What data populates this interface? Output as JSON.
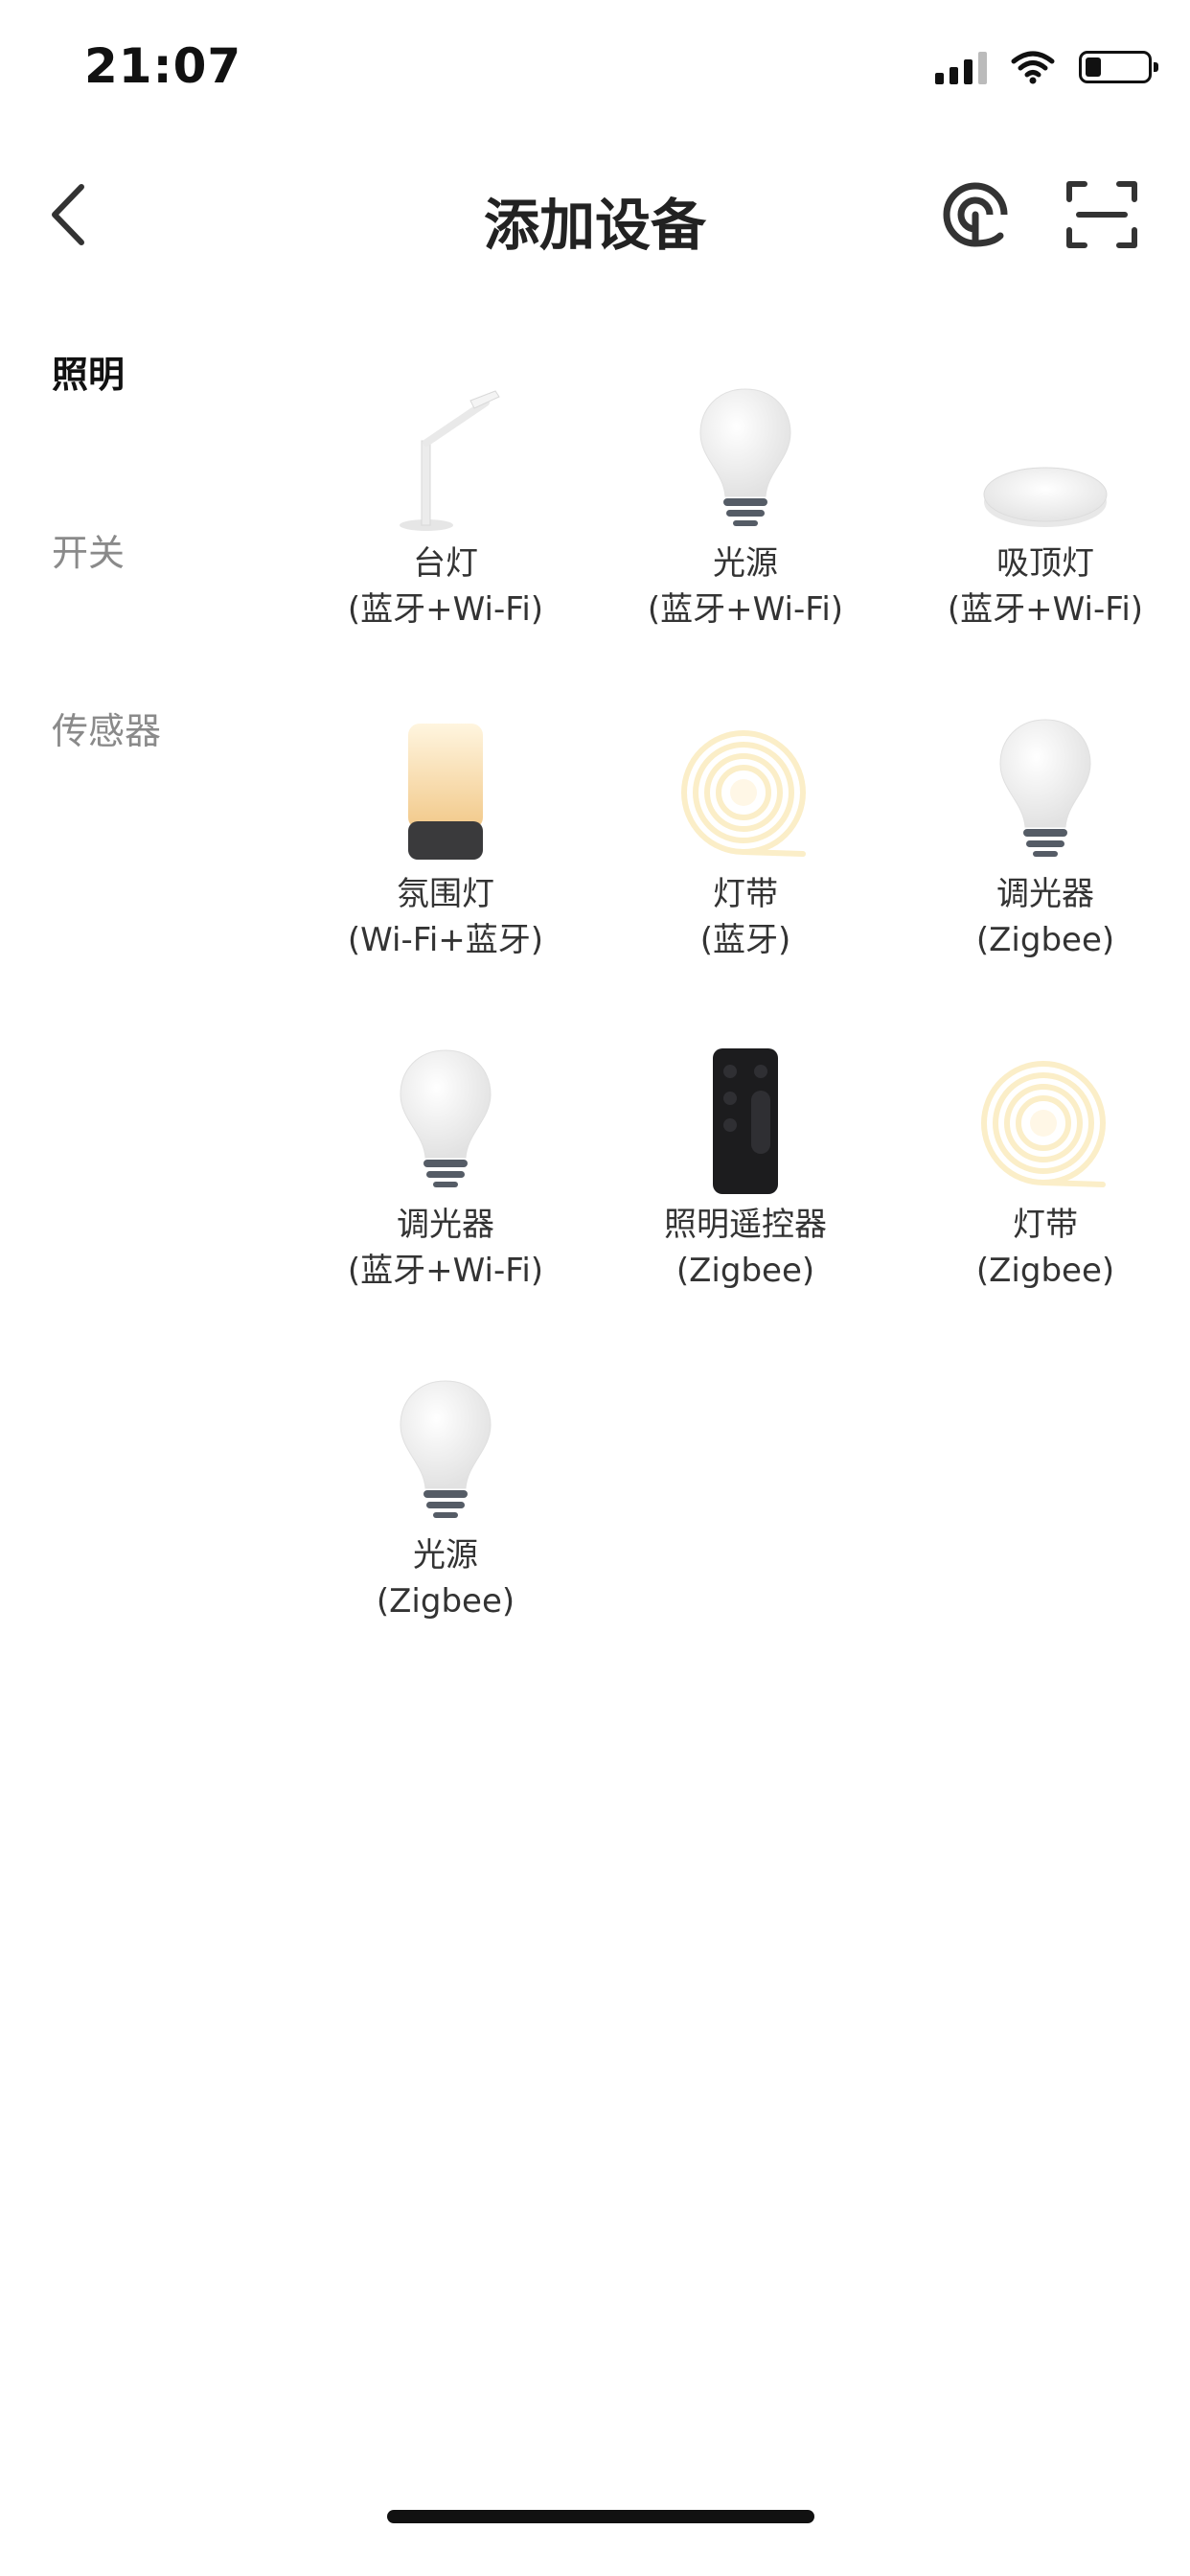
{
  "status": {
    "time": "21:07"
  },
  "nav": {
    "title": "添加设备"
  },
  "categories": [
    {
      "label": "照明",
      "active": true
    },
    {
      "label": "开关",
      "active": false
    },
    {
      "label": "传感器",
      "active": false
    }
  ],
  "devices": [
    {
      "name": "台灯",
      "protocol": "(蓝牙+Wi-Fi)",
      "icon": "desk-lamp-icon"
    },
    {
      "name": "光源",
      "protocol": "(蓝牙+Wi-Fi)",
      "icon": "bulb-icon"
    },
    {
      "name": "吸顶灯",
      "protocol": "(蓝牙+Wi-Fi)",
      "icon": "ceiling-light-icon"
    },
    {
      "name": "氛围灯",
      "protocol": "(Wi-Fi+蓝牙)",
      "icon": "ambient-light-icon"
    },
    {
      "name": "灯带",
      "protocol": "(蓝牙)",
      "icon": "light-strip-icon"
    },
    {
      "name": "调光器",
      "protocol": "(Zigbee)",
      "icon": "bulb-icon"
    },
    {
      "name": "调光器",
      "protocol": "(蓝牙+Wi-Fi)",
      "icon": "bulb-icon"
    },
    {
      "name": "照明遥控器",
      "protocol": "(Zigbee)",
      "icon": "remote-control-icon"
    },
    {
      "name": "灯带",
      "protocol": "(Zigbee)",
      "icon": "light-strip-icon"
    },
    {
      "name": "光源",
      "protocol": "(Zigbee)",
      "icon": "bulb-icon"
    }
  ]
}
